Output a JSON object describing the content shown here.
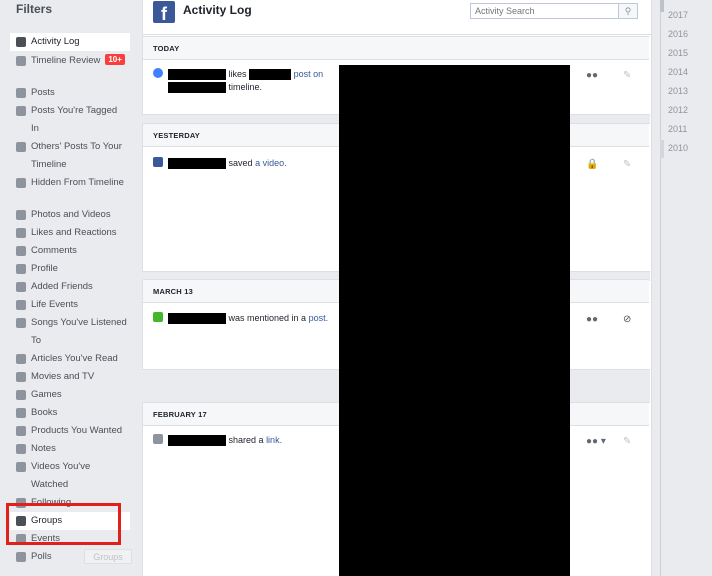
{
  "sidebar": {
    "title": "Filters",
    "items": [
      {
        "label": "Activity Log",
        "icon": "facebook-icon"
      },
      {
        "label": "Timeline Review",
        "icon": "timeline-review-icon",
        "badge": "10+"
      },
      {
        "label": "Posts",
        "icon": "person-icon"
      },
      {
        "label": "Posts You're Tagged",
        "icon": "tag-icon",
        "wrap": "In"
      },
      {
        "label": "Others' Posts To Your",
        "icon": "speech-bubble-icon",
        "wrap": "Timeline"
      },
      {
        "label": "Hidden From Timeline",
        "icon": "hidden-icon"
      },
      {
        "label": "Photos and Videos",
        "icon": "photos-icon"
      },
      {
        "label": "Likes and Reactions",
        "icon": "thumbs-up-icon"
      },
      {
        "label": "Comments",
        "icon": "comment-icon"
      },
      {
        "label": "Profile",
        "icon": "info-icon"
      },
      {
        "label": "Added Friends",
        "icon": "friends-icon"
      },
      {
        "label": "Life Events",
        "icon": "flag-icon"
      },
      {
        "label": "Songs You've Listened",
        "icon": "music-icon",
        "wrap": "To"
      },
      {
        "label": "Articles You've Read",
        "icon": "article-icon"
      },
      {
        "label": "Movies and TV",
        "icon": "video-camera-icon"
      },
      {
        "label": "Games",
        "icon": "puzzle-icon"
      },
      {
        "label": "Books",
        "icon": "book-icon"
      },
      {
        "label": "Products You Wanted",
        "icon": "shopping-bag-icon"
      },
      {
        "label": "Notes",
        "icon": "note-icon"
      },
      {
        "label": "Videos You've",
        "icon": "video-icon",
        "wrap": "Watched"
      },
      {
        "label": "Following",
        "icon": "following-icon"
      },
      {
        "label": "Groups",
        "icon": "groups-icon"
      },
      {
        "label": "Events",
        "icon": "calendar-icon"
      },
      {
        "label": "Polls",
        "icon": "poll-icon"
      }
    ],
    "tooltip": "Groups"
  },
  "header": {
    "title": "Activity Log",
    "search_placeholder": "Activity Search"
  },
  "sections": [
    {
      "heading": "TODAY",
      "entry": {
        "pre": "likes",
        "link1": "post on",
        "post": "timeline."
      }
    },
    {
      "heading": "YESTERDAY",
      "entry": {
        "pre": "saved",
        "link1": "a video."
      }
    },
    {
      "heading": "MARCH 13",
      "entry": {
        "pre": "was mentioned in a",
        "link1": "post."
      }
    },
    {
      "heading": "FEBRUARY 17",
      "entry": {
        "pre": "shared a",
        "link1": "link."
      }
    }
  ],
  "years": [
    "2017",
    "2016",
    "2015",
    "2014",
    "2013",
    "2012",
    "2011",
    "2010"
  ],
  "colors": {
    "highlight": "#e0201a",
    "brand": "#3b5998",
    "link": "#365899"
  }
}
